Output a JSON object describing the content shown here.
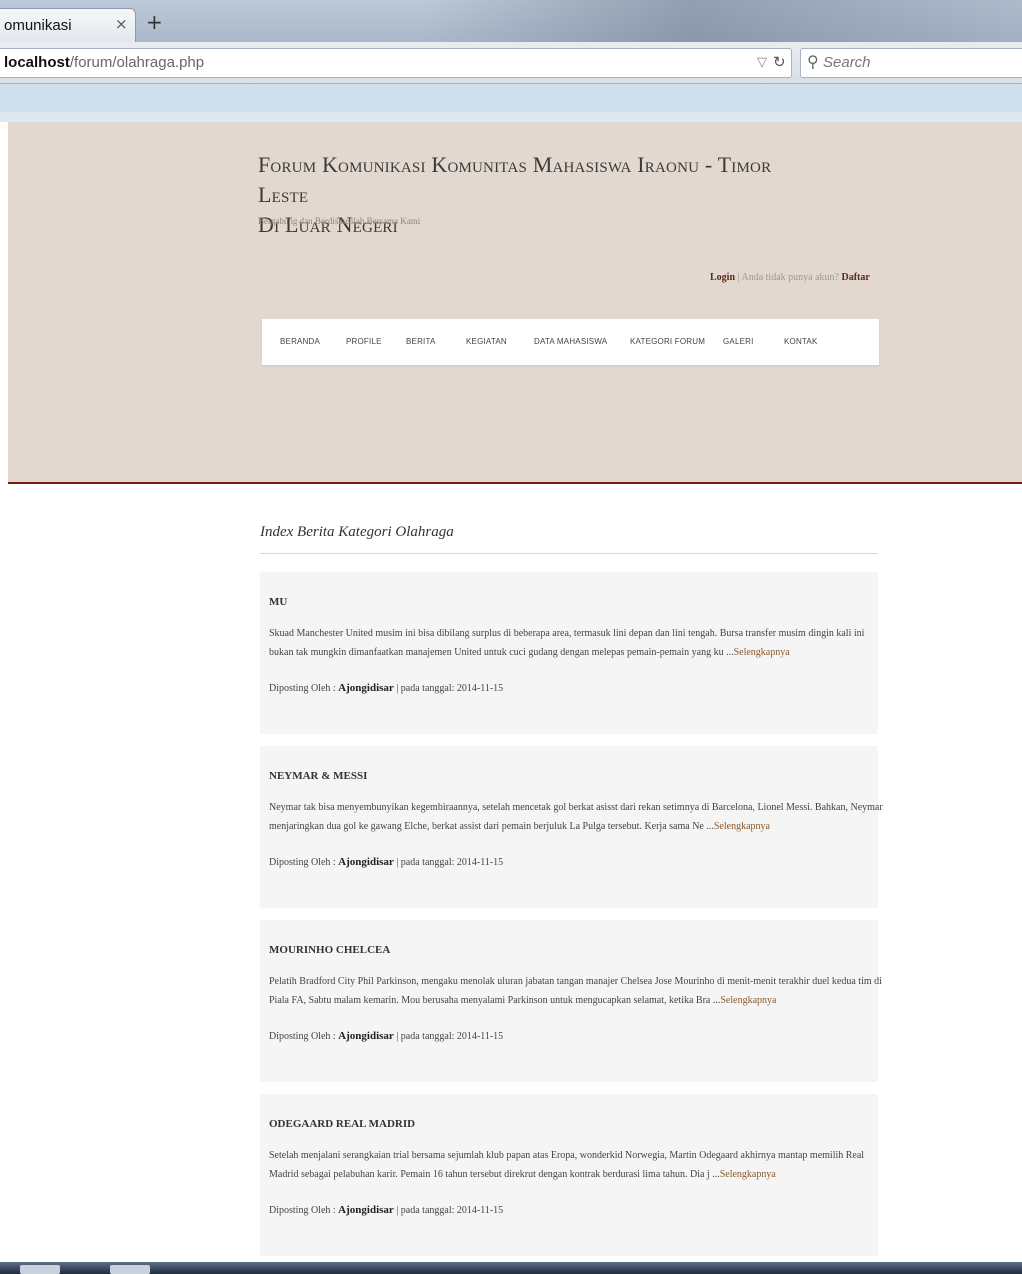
{
  "browser": {
    "tab_title": "omunikasi",
    "tab_close": "×",
    "new_tab": "+",
    "url_host": "localhost",
    "url_path": "/forum/olahraga.php",
    "search_placeholder": "Search"
  },
  "header": {
    "title_line1": "Forum Komunikasi Komunitas Mahasiswa Iraonu - Timor Leste",
    "title_line2": "Di Luar Negeri",
    "tagline": "Bergabung dan Berdiskusilah Bersama Kami",
    "login_label": "Login",
    "separator": "|",
    "no_account_text": "Anda tidak punya akun?",
    "register_label": "Daftar"
  },
  "nav": {
    "items": [
      "BERANDA",
      "PROFILE",
      "BERITA",
      "KEGIATAN",
      "DATA MAHASISWA",
      "KATEGORI FORUM",
      "GALERI",
      "KONTAK"
    ]
  },
  "content": {
    "section_title": "Index Berita Kategori Olahraga",
    "read_more": "Selengkapnya",
    "meta_prefix": "Diposting Oleh :",
    "meta_date_prefix": "| pada tanggal:",
    "posts": [
      {
        "title": "MU",
        "excerpt": "Skuad Manchester United musim ini bisa dibilang surplus di beberapa area, termasuk lini depan dan lini tengah. Bursa transfer musim dingin kali ini bukan tak mungkin dimanfaatkan manajemen United untuk cuci gudang dengan melepas pemain-pemain yang ku ...",
        "author": "Ajongidisar",
        "date": "2014-11-15"
      },
      {
        "title": "NEYMAR & MESSI",
        "excerpt": "Neymar tak bisa menyembunyikan kegembiraannya, setelah mencetak gol berkat asisst dari rekan setimnya di Barcelona, Lionel Messi. Bahkan, Neymar menjaringkan dua gol ke gawang Elche, berkat assist dari pemain berjuluk La Pulga tersebut. Kerja sama Ne ...",
        "author": "Ajongidisar",
        "date": "2014-11-15"
      },
      {
        "title": "MOURINHO CHELCEA",
        "excerpt": "Pelatih Bradford City Phil Parkinson, mengaku menolak uluran jabatan tangan manajer Chelsea Jose Mourinho di menit-menit terakhir duel kedua tim di Piala FA, Sabtu malam kemarin. Mou berusaha menyalami Parkinson untuk mengucapkan selamat, ketika Bra ...",
        "author": "Ajongidisar",
        "date": "2014-11-15"
      },
      {
        "title": "ODEGAARD REAL MADRID",
        "excerpt": "Setelah menjalani serangkaian trial bersama sejumlah klub papan atas Eropa, wonderkid Norwegia, Martin Odegaard akhirnya mantap memilih Real Madrid sebagai pelabuhan karir. Pemain 16 tahun tersebut direkrut dengan kontrak berdurasi lima tahun. Dia j ...",
        "author": "Ajongidisar",
        "date": "2014-11-15"
      }
    ]
  }
}
